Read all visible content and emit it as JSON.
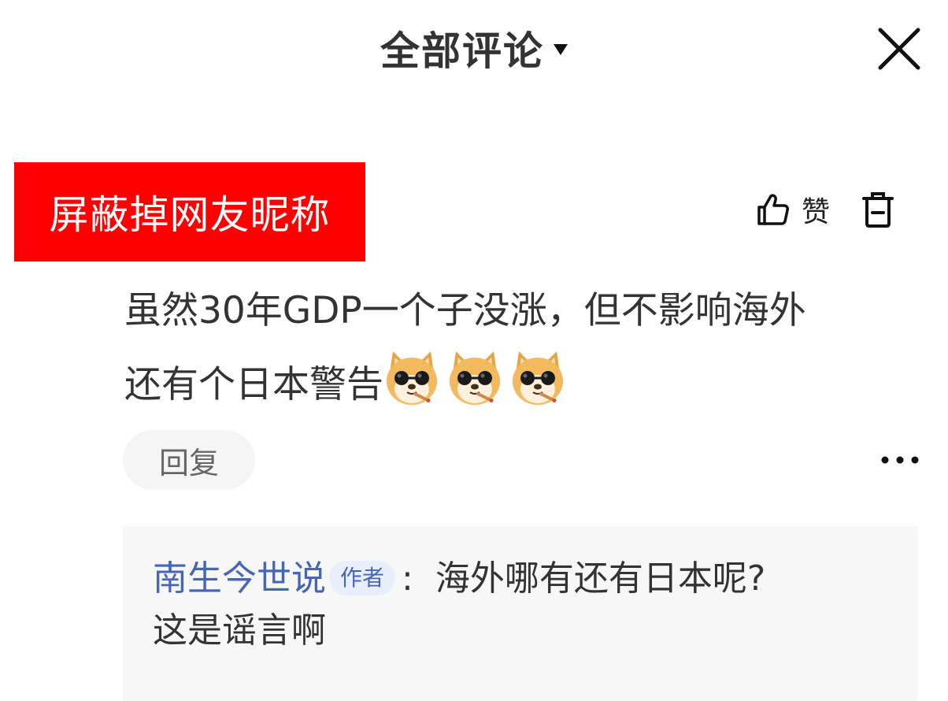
{
  "header": {
    "title": "全部评论"
  },
  "comment": {
    "nickname_mask_label": "屏蔽掉网友昵称",
    "like_label": "赞",
    "text_line1": "虽然30年GDP一个子没涨，但不影响海外",
    "text_line2": "还有个日本警告",
    "emojis": [
      "doge-sunglasses-cigar",
      "doge-sunglasses-cigar",
      "doge-sunglasses-cigar"
    ],
    "reply_label": "回复"
  },
  "sub_reply": {
    "author": "南生今世说",
    "badge": "作者",
    "colon": ":",
    "text_line1": "海外哪有还有日本呢?",
    "text_line2": "这是谣言啊"
  },
  "colors": {
    "mask_red": "#ff0000",
    "author_blue": "#4566b8",
    "sub_reply_bg": "#f7f7f7"
  }
}
